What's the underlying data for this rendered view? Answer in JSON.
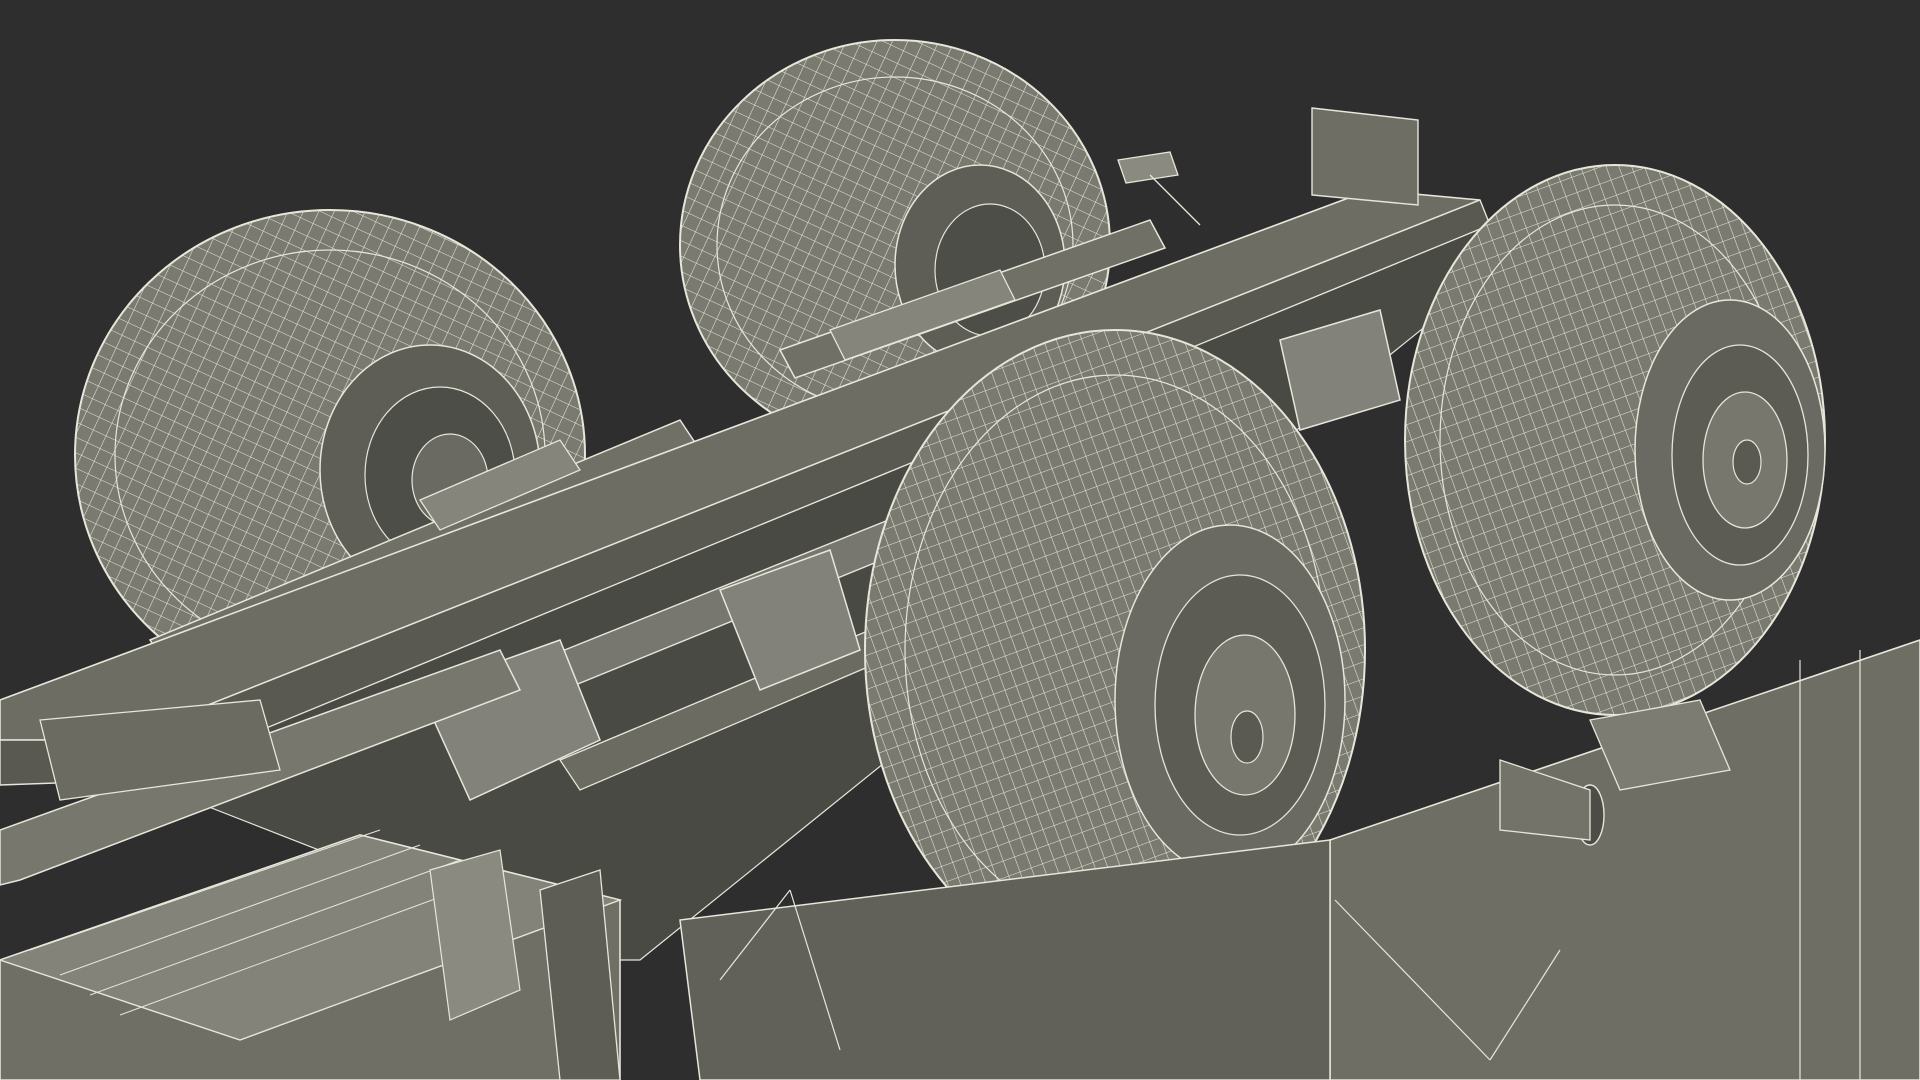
{
  "render": {
    "subject": "wireframe-vehicle-chassis",
    "colors": {
      "background": "#2e2e2e",
      "surface": "#7a7a70",
      "surface_dark": "#55554d",
      "surface_light": "#909086",
      "wire": "#e6e6da",
      "wire_dim": "#b8b8aa",
      "shadow": "#45453f"
    },
    "components": {
      "wheels": 4,
      "frame_rails": 2,
      "cross_members": 3
    }
  }
}
